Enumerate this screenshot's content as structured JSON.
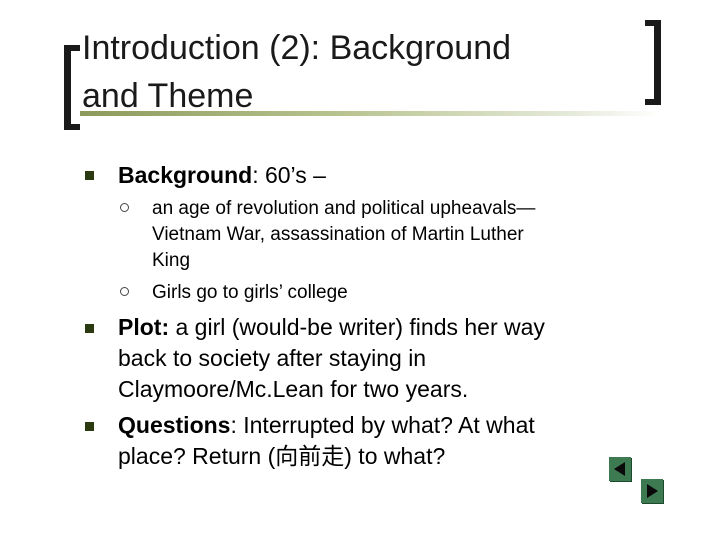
{
  "slide": {
    "title_line1": "Introduction (2): Background",
    "title_line2": "and Theme"
  },
  "bullets": {
    "background_label": "Background",
    "background_rest": ": 60’s –",
    "sub1_line1": "an age of revolution and political upheavals—",
    "sub1_line2": "Vietnam War, assassination of Martin Luther",
    "sub1_line3": "King",
    "sub2": "Girls go to girls’ college",
    "plot_label": "Plot:",
    "plot_line1": " a girl (would-be writer) finds her way",
    "plot_line2": "back to society after staying in",
    "plot_line3": "Claymoore/Mc.Lean for two years.",
    "questions_label": "Questions",
    "questions_line1": ": Interrupted by what?  At what",
    "questions_line2": "place?  Return (向前走) to what?"
  },
  "nav": {
    "prev_icon": "triangle-left-icon",
    "next_icon": "triangle-right-icon",
    "color": "#3d7a52"
  }
}
